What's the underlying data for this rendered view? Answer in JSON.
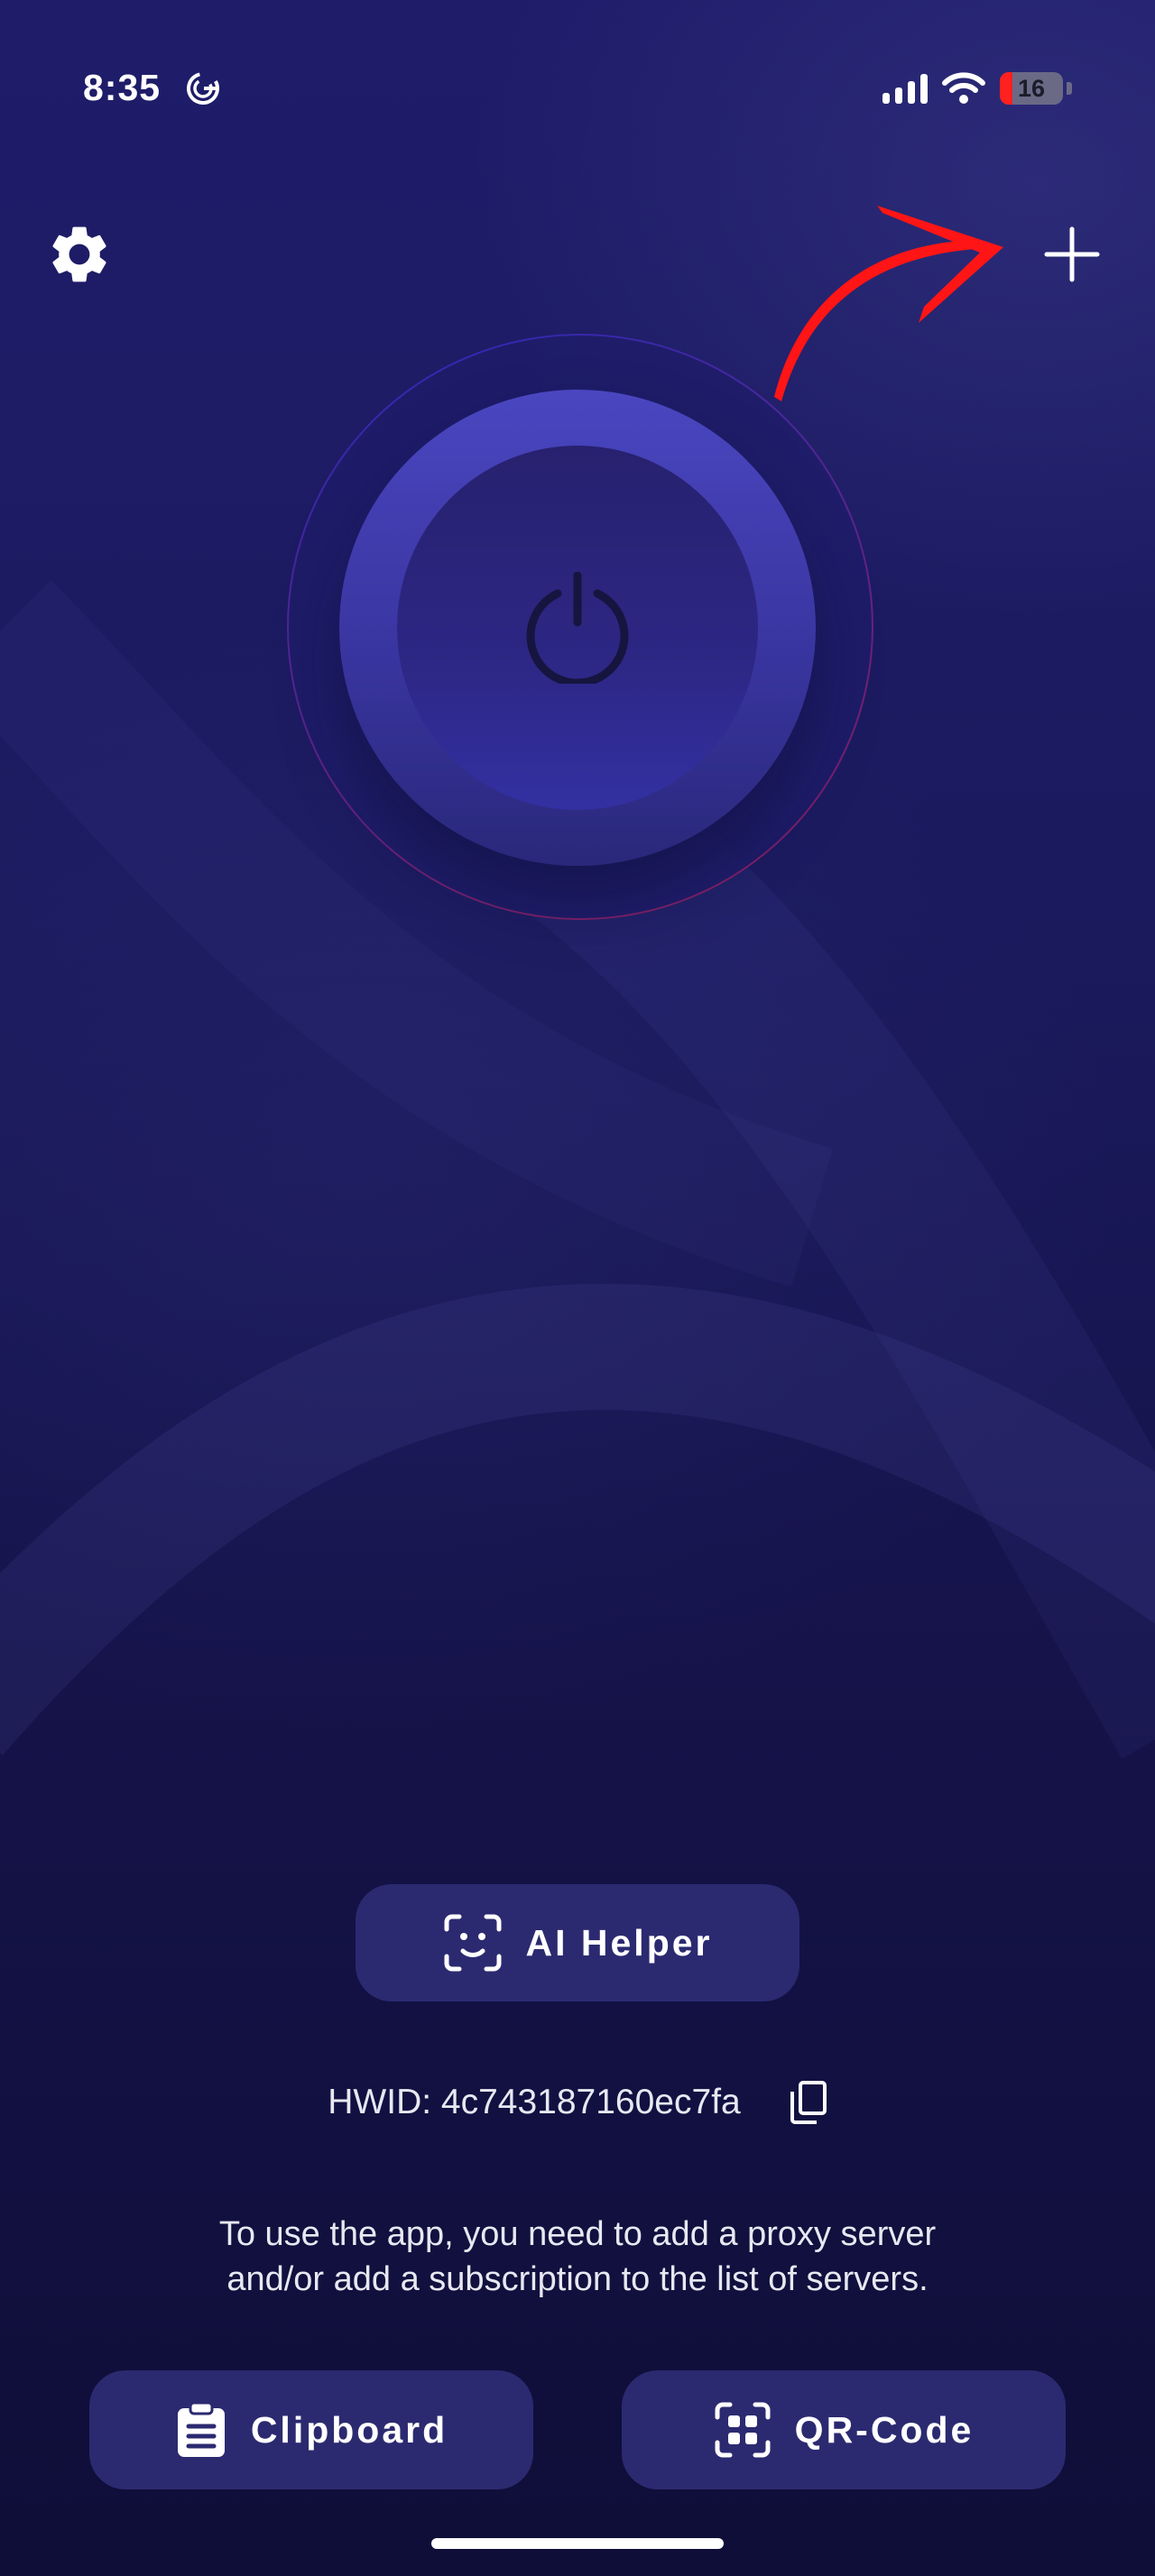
{
  "status_bar": {
    "time": "8:35",
    "battery": "16",
    "icons": [
      "g-icon",
      "signal-icon",
      "wifi-icon",
      "battery-icon"
    ]
  },
  "header": {
    "settings_icon": "gear-icon",
    "add_icon": "plus-icon"
  },
  "power": {
    "icon": "power-icon"
  },
  "ai_helper": {
    "label": "AI Helper",
    "icon": "face-scan-icon"
  },
  "hwid": {
    "text": "HWID: 4c743187160ec7fa",
    "copy_icon": "copy-icon"
  },
  "info": {
    "text": "To use the app, you need to add a proxy server and/or add a subscription to the list of servers."
  },
  "actions": {
    "clipboard": {
      "label": "Clipboard",
      "icon": "clipboard-icon"
    },
    "qr": {
      "label": "QR-Code",
      "icon": "qr-scan-icon"
    }
  },
  "colors": {
    "background": "#1b1a5e",
    "button_bg": "#2b2a70",
    "power_outer": "#4a46c0",
    "power_inner": "#2d2785",
    "annotation": "#ff1515"
  }
}
